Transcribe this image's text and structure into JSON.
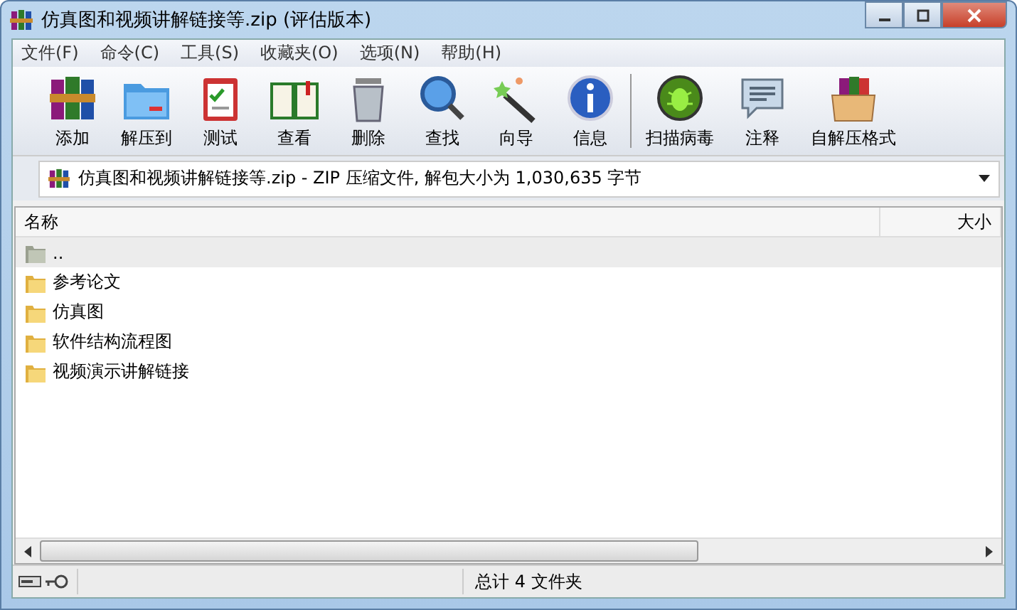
{
  "window": {
    "title": "仿真图和视频讲解链接等.zip (评估版本)"
  },
  "menu": [
    "文件(F)",
    "命令(C)",
    "工具(S)",
    "收藏夹(O)",
    "选项(N)",
    "帮助(H)"
  ],
  "toolbar": {
    "groups": [
      [
        "添加",
        "解压到",
        "测试",
        "查看",
        "删除",
        "查找",
        "向导",
        "信息"
      ],
      [
        "扫描病毒",
        "注释",
        "自解压格式"
      ]
    ]
  },
  "address": {
    "value": "仿真图和视频讲解链接等.zip - ZIP 压缩文件, 解包大小为 1,030,635 字节"
  },
  "table": {
    "columns": [
      "名称",
      "大小"
    ],
    "rows": [
      {
        "kind": "parent",
        "name": "..",
        "selected": true
      },
      {
        "kind": "folder",
        "name": "参考论文",
        "selected": false
      },
      {
        "kind": "folder",
        "name": "仿真图",
        "selected": false
      },
      {
        "kind": "folder",
        "name": "软件结构流程图",
        "selected": false
      },
      {
        "kind": "folder",
        "name": "视频演示讲解链接",
        "selected": false
      }
    ]
  },
  "status_bar": {
    "text": "总计 4 文件夹"
  }
}
